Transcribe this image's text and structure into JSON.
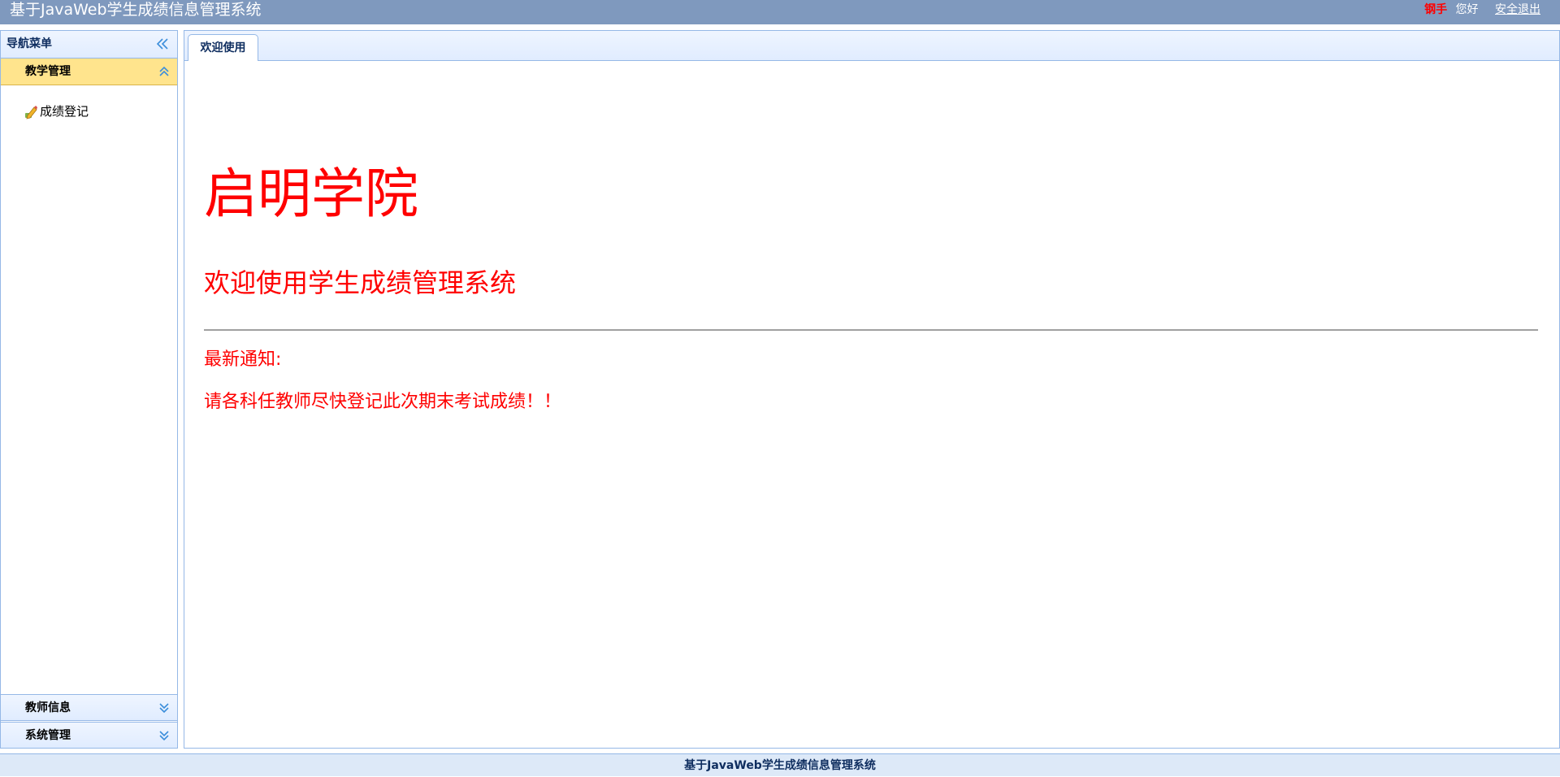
{
  "header": {
    "app_title": "基于JavaWeb学生成绩信息管理系统",
    "user_name": "钢手",
    "greeting": "您好",
    "logout_label": "安全退出"
  },
  "nav": {
    "title": "导航菜单",
    "collapse_icon": "double-chevron-left-icon",
    "sections": [
      {
        "label": "教学管理",
        "expanded": true,
        "icon": "double-chevron-up-icon",
        "items": [
          {
            "label": "成绩登记",
            "icon": "pencil-edit-icon"
          }
        ]
      },
      {
        "label": "教师信息",
        "expanded": false,
        "icon": "double-chevron-down-icon"
      },
      {
        "label": "系统管理",
        "expanded": false,
        "icon": "double-chevron-down-icon"
      }
    ]
  },
  "tabs": [
    {
      "label": "欢迎使用",
      "active": true
    }
  ],
  "welcome": {
    "school_name": "启明学院",
    "welcome_text": "欢迎使用学生成绩管理系统",
    "notice_label": "最新通知:",
    "notice_body": "请各科任教师尽快登记此次期末考试成绩！！"
  },
  "footer": {
    "text": "基于JavaWeb学生成绩信息管理系统"
  },
  "colors": {
    "header_bg": "#7f99be",
    "accent_text": "#ff0000",
    "selected_section_bg": "#ffe48d",
    "panel_border": "#95b8e7"
  }
}
